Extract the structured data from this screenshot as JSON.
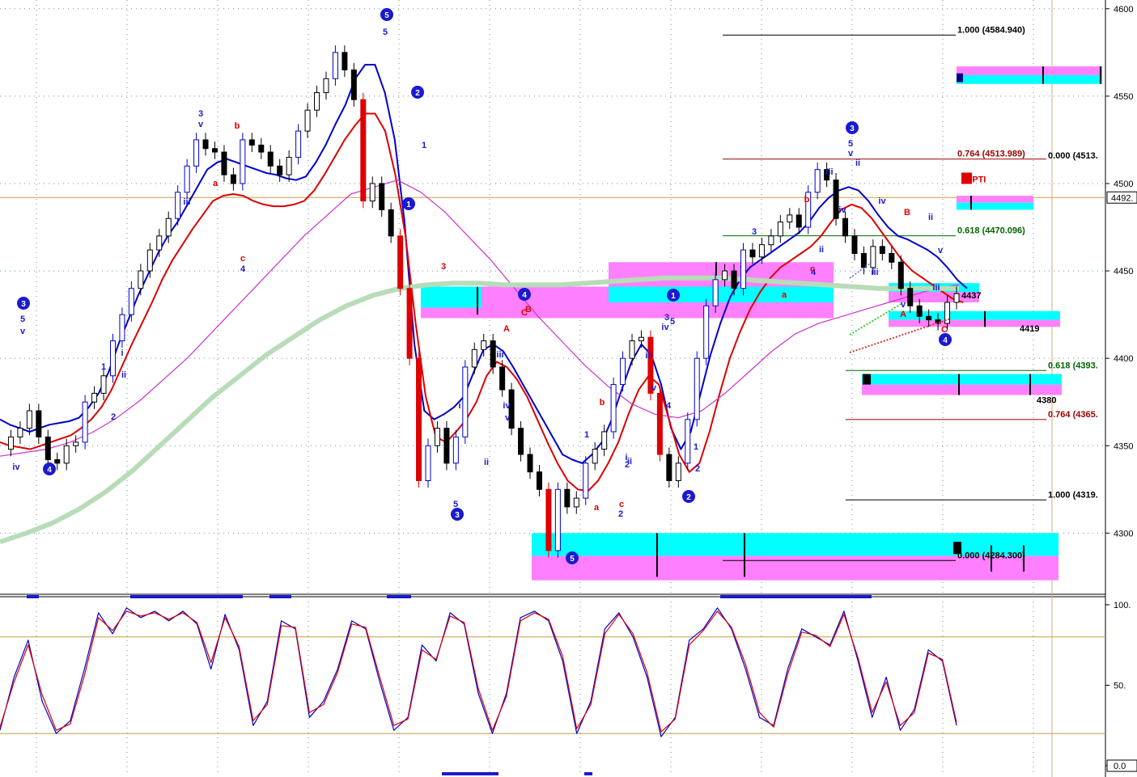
{
  "chart_data": {
    "type": "line",
    "title": "",
    "price_axis": {
      "ylim": [
        4265,
        4605
      ],
      "ticks": [
        {
          "value": 4600,
          "label": "4600"
        },
        {
          "value": 4550,
          "label": "4550"
        },
        {
          "value": 4500,
          "label": "4500"
        },
        {
          "value": 4450,
          "label": "4450"
        },
        {
          "value": 4400,
          "label": "4400"
        },
        {
          "value": 4350,
          "label": "4350"
        },
        {
          "value": 4300,
          "label": "4300"
        }
      ],
      "current_price": {
        "value": 4492,
        "label": "4492."
      }
    },
    "oscillator_axis": {
      "ylim": [
        -5,
        105
      ],
      "ticks": [
        {
          "value": 100,
          "label": "100."
        },
        {
          "value": 50,
          "label": "50."
        },
        {
          "value": 0,
          "label": "0.0"
        }
      ],
      "bands": [
        80,
        20
      ]
    },
    "series": [
      {
        "name": "",
        "role": "price",
        "color": "#000000",
        "values": [
          4348,
          4355,
          4360,
          4370,
          4355,
          4342,
          4340,
          4350,
          4352,
          4375,
          4380,
          4390,
          4410,
          4425,
          4440,
          4450,
          4462,
          4470,
          4480,
          4495,
          4510,
          4525,
          4520,
          4518,
          4505,
          4500,
          4525,
          4522,
          4518,
          4510,
          4505,
          4515,
          4530,
          4542,
          4552,
          4560,
          4575,
          4565,
          4548,
          4490,
          4500,
          4485,
          4470,
          4440,
          4400,
          4330,
          4350,
          4360,
          4340,
          4355,
          4395,
          4405,
          4410,
          4395,
          4382,
          4360,
          4345,
          4335,
          4325,
          4290,
          4325,
          4315,
          4320,
          4340,
          4348,
          4358,
          4385,
          4400,
          4410,
          4412,
          4380,
          4345,
          4330,
          4340,
          4365,
          4400,
          4430,
          4445,
          4450,
          4440,
          4462,
          4458,
          4465,
          4470,
          4478,
          4482,
          4475,
          4495,
          4508,
          4502,
          4480,
          4470,
          4460,
          4452,
          4464,
          4460,
          4455,
          4440,
          4430,
          4424,
          4422,
          4420,
          4432,
          4437
        ]
      },
      {
        "name": "",
        "role": "moving-average-blue",
        "color": "#0000cc",
        "values": [
          4365,
          4362,
          4360,
          4358,
          4360,
          4362,
          4363,
          4364,
          4366,
          4372,
          4380,
          4392,
          4408,
          4422,
          4436,
          4448,
          4460,
          4470,
          4478,
          4488,
          4498,
          4508,
          4512,
          4514,
          4512,
          4510,
          4508,
          4506,
          4505,
          4503,
          4502,
          4504,
          4512,
          4522,
          4534,
          4545,
          4560,
          4568,
          4568,
          4552,
          4525,
          4478,
          4408,
          4370,
          4365,
          4368,
          4372,
          4378,
          4392,
          4405,
          4408,
          4404,
          4395,
          4385,
          4375,
          4365,
          4355,
          4345,
          4342,
          4340,
          4345,
          4352,
          4365,
          4382,
          4398,
          4408,
          4402,
          4385,
          4360,
          4348,
          4358,
          4380,
          4402,
          4420,
          4435,
          4445,
          4452,
          4456,
          4460,
          4464,
          4468,
          4472,
          4478,
          4486,
          4492,
          4496,
          4498,
          4496,
          4490,
          4482,
          4475,
          4470,
          4468,
          4465,
          4462,
          4458,
          4452,
          4445,
          4440
        ]
      },
      {
        "name": "",
        "role": "moving-average-red",
        "color": "#dd0000",
        "values": [
          4352,
          4350,
          4349,
          4348,
          4350,
          4352,
          4354,
          4356,
          4360,
          4365,
          4372,
          4382,
          4395,
          4408,
          4420,
          4432,
          4445,
          4456,
          4465,
          4474,
          4482,
          4490,
          4493,
          4494,
          4493,
          4490,
          4488,
          4487,
          4487,
          4488,
          4490,
          4496,
          4505,
          4515,
          4525,
          4533,
          4540,
          4540,
          4530,
          4505,
          4470,
          4420,
          4378,
          4355,
          4352,
          4358,
          4365,
          4375,
          4390,
          4398,
          4395,
          4388,
          4378,
          4365,
          4352,
          4340,
          4330,
          4325,
          4324,
          4330,
          4340,
          4352,
          4368,
          4382,
          4390,
          4385,
          4365,
          4345,
          4335,
          4340,
          4358,
          4380,
          4400,
          4415,
          4428,
          4438,
          4446,
          4452,
          4456,
          4460,
          4464,
          4470,
          4478,
          4485,
          4488,
          4486,
          4480,
          4472,
          4464,
          4456,
          4450,
          4446,
          4442,
          4438,
          4434,
          4432
        ]
      },
      {
        "name": "",
        "role": "moving-average-magenta",
        "color": "#cc33cc",
        "values": [
          4344,
          4346,
          4348,
          4352,
          4358,
          4366,
          4376,
          4388,
          4400,
          4414,
          4428,
          4442,
          4456,
          4470,
          4482,
          4494,
          4498,
          4502,
          4495,
          4484,
          4470,
          4456,
          4440,
          4424,
          4410,
          4396,
          4384,
          4374,
          4368,
          4366,
          4370,
          4380,
          4392,
          4404,
          4414,
          4420,
          4424,
          4428,
          4432,
          4436,
          4440,
          4442
        ]
      },
      {
        "name": "",
        "role": "moving-average-green",
        "color": "#b8dcb8",
        "values": [
          4295,
          4300,
          4306,
          4314,
          4324,
          4336,
          4350,
          4364,
          4378,
          4390,
          4402,
          4412,
          4422,
          4430,
          4436,
          4440,
          4442,
          4443,
          4443,
          4442,
          4442,
          4442,
          4443,
          4444,
          4445,
          4446,
          4446,
          4446,
          4445,
          4444,
          4443,
          4442,
          4441,
          4440,
          4440,
          4440,
          4440
        ]
      }
    ],
    "oscillator_series": [
      {
        "name": "",
        "color": "#0000cc",
        "values": [
          22,
          55,
          78,
          40,
          20,
          28,
          60,
          95,
          82,
          98,
          92,
          96,
          90,
          96,
          88,
          60,
          94,
          72,
          25,
          40,
          90,
          85,
          30,
          40,
          60,
          90,
          85,
          52,
          22,
          30,
          75,
          65,
          95,
          88,
          45,
          20,
          45,
          92,
          96,
          90,
          65,
          20,
          40,
          85,
          95,
          80,
          55,
          18,
          30,
          78,
          85,
          98,
          85,
          60,
          30,
          25,
          60,
          85,
          80,
          75,
          96,
          65,
          30,
          55,
          22,
          35,
          72,
          65,
          25
        ]
      },
      {
        "name": "",
        "color": "#dd0000",
        "values": [
          24,
          52,
          75,
          44,
          22,
          26,
          56,
          92,
          84,
          96,
          93,
          95,
          91,
          95,
          89,
          64,
          92,
          74,
          28,
          38,
          87,
          86,
          33,
          38,
          58,
          88,
          86,
          55,
          25,
          29,
          72,
          66,
          93,
          89,
          48,
          22,
          43,
          90,
          95,
          91,
          68,
          23,
          38,
          82,
          94,
          82,
          58,
          21,
          29,
          75,
          84,
          96,
          86,
          63,
          33,
          24,
          57,
          83,
          81,
          74,
          94,
          67,
          33,
          52,
          25,
          33,
          70,
          66,
          27
        ]
      }
    ],
    "fibonacci_levels": [
      {
        "label": "1.000 (4584.940)",
        "value": 4584.94,
        "color": "#000000"
      },
      {
        "label": "0.764 (4513.989)",
        "value": 4513.989,
        "color": "#990000"
      },
      {
        "label": "0.000 (4513.",
        "value": 4513,
        "color": "#000000"
      },
      {
        "label": "0.618 (4470.096)",
        "value": 4470.096,
        "color": "#006600"
      },
      {
        "label": "0.618 (4393.",
        "value": 4393,
        "color": "#006600"
      },
      {
        "label": "0.764 (4365.",
        "value": 4365,
        "color": "#990000"
      },
      {
        "label": "1.000 (4319.",
        "value": 4319,
        "color": "#000000"
      },
      {
        "label": "0.000 (4284.300)",
        "value": 4284.3,
        "color": "#000000"
      }
    ],
    "price_notes": [
      {
        "label": "4437",
        "value": 4437
      },
      {
        "label": "4419",
        "value": 4419
      },
      {
        "label": "4380",
        "value": 4380
      }
    ],
    "indicator_tag": {
      "label": "63PTI",
      "color": "#dd0000"
    },
    "zones": [
      {
        "name": "cyan",
        "color": "#00ffff"
      },
      {
        "name": "magenta",
        "color": "#ff80ff"
      }
    ],
    "wave_labels": [
      {
        "text": "3",
        "style": "circle"
      },
      {
        "text": "5",
        "style": "blue"
      },
      {
        "text": "v",
        "style": "blue"
      },
      {
        "text": "iv",
        "style": "blue"
      },
      {
        "text": "4",
        "style": "circle"
      },
      {
        "text": "1",
        "style": "blue"
      },
      {
        "text": "2",
        "style": "blue"
      },
      {
        "text": "i",
        "style": "blue"
      },
      {
        "text": "ii",
        "style": "blue"
      },
      {
        "text": "iii",
        "style": "blue"
      },
      {
        "text": "3",
        "style": "blue"
      },
      {
        "text": "v",
        "style": "blue"
      },
      {
        "text": "b",
        "style": "red"
      },
      {
        "text": "a",
        "style": "red"
      },
      {
        "text": "c",
        "style": "red"
      },
      {
        "text": "4",
        "style": "blue"
      },
      {
        "text": "5",
        "style": "circle"
      },
      {
        "text": "5",
        "style": "blue"
      },
      {
        "text": "2",
        "style": "circle"
      },
      {
        "text": "1",
        "style": "circle"
      },
      {
        "text": "1",
        "style": "blue"
      },
      {
        "text": "3",
        "style": "red"
      },
      {
        "text": "i",
        "style": "blue"
      },
      {
        "text": "ii",
        "style": "blue"
      },
      {
        "text": "5",
        "style": "blue"
      },
      {
        "text": "3",
        "style": "circle"
      },
      {
        "text": "4",
        "style": "circle"
      },
      {
        "text": "C",
        "style": "red"
      },
      {
        "text": "A",
        "style": "red"
      },
      {
        "text": "B",
        "style": "red"
      },
      {
        "text": "iii",
        "style": "blue"
      },
      {
        "text": "iv",
        "style": "blue"
      },
      {
        "text": "v",
        "style": "blue"
      },
      {
        "text": "5",
        "style": "circle"
      },
      {
        "text": "a",
        "style": "red"
      },
      {
        "text": "b",
        "style": "red"
      },
      {
        "text": "c",
        "style": "red"
      },
      {
        "text": "2",
        "style": "blue"
      },
      {
        "text": "1",
        "style": "blue"
      },
      {
        "text": "2",
        "style": "blue"
      },
      {
        "text": "iii",
        "style": "blue"
      },
      {
        "text": "i",
        "style": "blue"
      },
      {
        "text": "ii",
        "style": "blue"
      },
      {
        "text": "3",
        "style": "blue"
      },
      {
        "text": "5",
        "style": "blue"
      },
      {
        "text": "iv",
        "style": "blue"
      },
      {
        "text": "v",
        "style": "blue"
      },
      {
        "text": "4",
        "style": "blue"
      },
      {
        "text": "2",
        "style": "circle"
      },
      {
        "text": "1",
        "style": "blue"
      },
      {
        "text": "2",
        "style": "blue"
      },
      {
        "text": "1",
        "style": "circle"
      },
      {
        "text": "3",
        "style": "blue"
      },
      {
        "text": "4",
        "style": "blue"
      },
      {
        "text": "a",
        "style": "red"
      },
      {
        "text": "c",
        "style": "red"
      },
      {
        "text": "b",
        "style": "red"
      },
      {
        "text": "3",
        "style": "circle"
      },
      {
        "text": "5",
        "style": "blue"
      },
      {
        "text": "v",
        "style": "blue"
      },
      {
        "text": "iii",
        "style": "blue"
      },
      {
        "text": "ii",
        "style": "blue"
      },
      {
        "text": "iv",
        "style": "blue"
      },
      {
        "text": "ii",
        "style": "blue"
      },
      {
        "text": "iii",
        "style": "blue"
      },
      {
        "text": "iv",
        "style": "blue"
      },
      {
        "text": "B",
        "style": "red"
      },
      {
        "text": "A",
        "style": "red"
      },
      {
        "text": "ii",
        "style": "blue"
      },
      {
        "text": "iii",
        "style": "blue"
      },
      {
        "text": "v",
        "style": "blue"
      },
      {
        "text": "C",
        "style": "red"
      },
      {
        "text": "4",
        "style": "circle"
      },
      {
        "text": "v",
        "style": "blue"
      }
    ],
    "grid": true,
    "legend": "none"
  }
}
